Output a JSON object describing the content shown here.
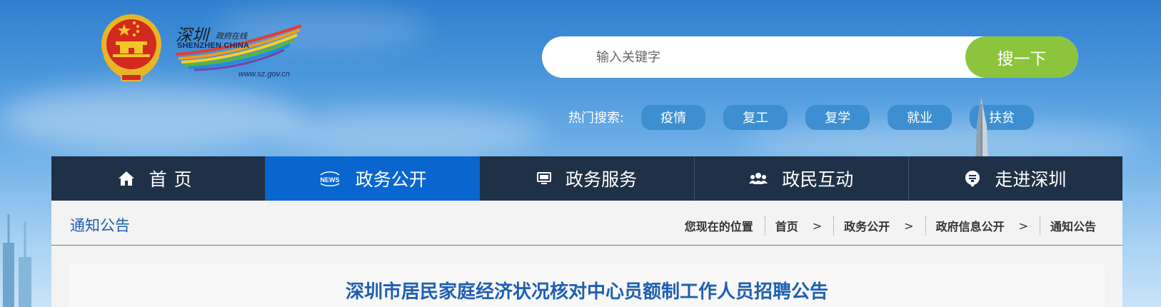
{
  "header": {
    "logo": {
      "chinese": "深圳",
      "chinese_sub": "政府在线",
      "english": "SHENZHEN  CHINA",
      "url": "www.sz.gov.cn"
    },
    "search": {
      "placeholder": "输入关键字",
      "button_label": "搜一下"
    },
    "hot_search": {
      "label": "热门搜索:",
      "tags": [
        "疫情",
        "复工",
        "复学",
        "就业",
        "扶贫"
      ]
    }
  },
  "nav": {
    "items": [
      {
        "label": "首页",
        "icon": "home-icon"
      },
      {
        "label": "政务公开",
        "icon": "news-icon",
        "active": true
      },
      {
        "label": "政务服务",
        "icon": "monitor-icon"
      },
      {
        "label": "政民互动",
        "icon": "people-icon"
      },
      {
        "label": "走进深圳",
        "icon": "shenzhen-icon"
      }
    ]
  },
  "content": {
    "section_title": "通知公告",
    "breadcrumb": {
      "lead": "您现在的位置",
      "items": [
        "首页",
        "政务公开",
        "政府信息公开",
        "通知公告"
      ],
      "separator": ">"
    },
    "article_title": "深圳市居民家庭经济状况核对中心员额制工作人员招聘公告"
  },
  "colors": {
    "nav_bg": "#1e3147",
    "nav_active": "#0a66cf",
    "search_button": "#8cc43c",
    "hot_tag": "#3d8fd1",
    "title_blue": "#1f5fb0",
    "divider_green": "#3a9c4a"
  }
}
